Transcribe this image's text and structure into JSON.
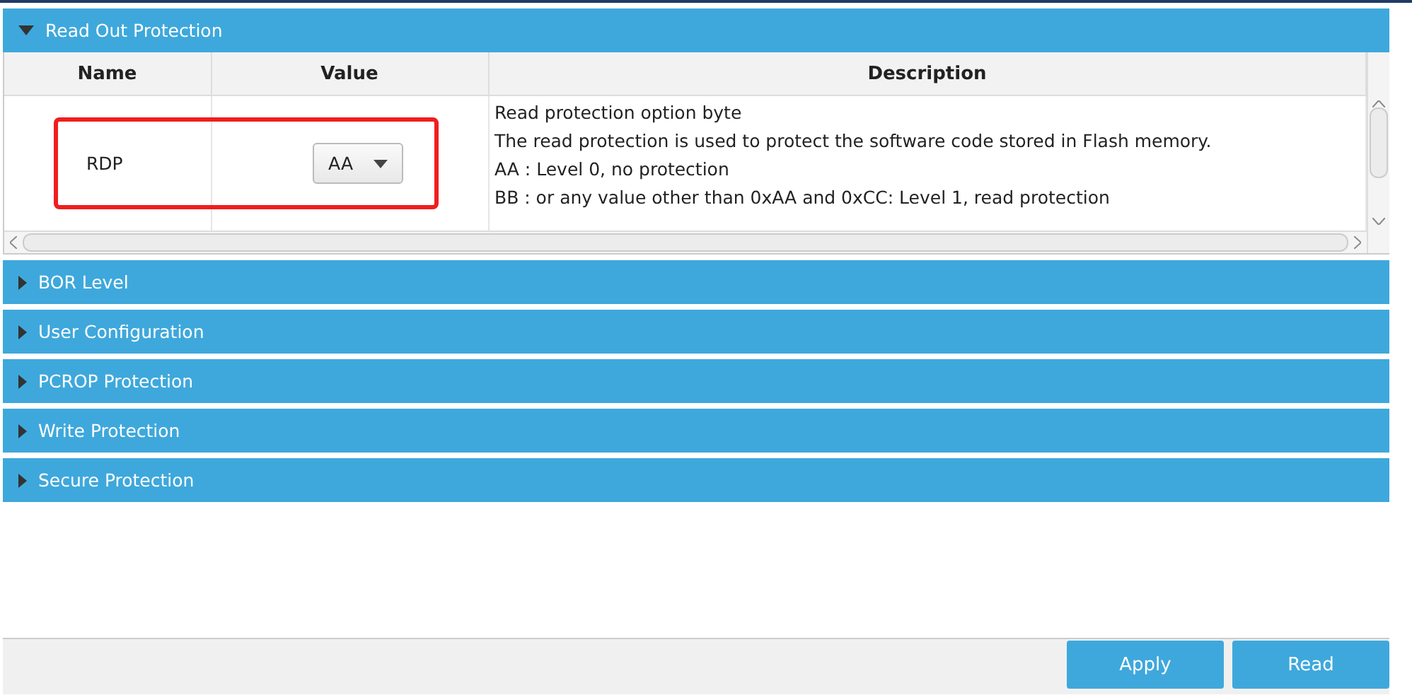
{
  "sections": [
    {
      "title": "Read Out Protection",
      "expanded": true,
      "table": {
        "columns": [
          "Name",
          "Value",
          "Description"
        ],
        "rows": [
          {
            "name": "RDP",
            "value": "AA",
            "description": [
              "Read protection option byte",
              "The read protection is used to protect the software code stored in Flash memory.",
              "AA : Level 0, no protection",
              "BB : or any value other than 0xAA and 0xCC: Level 1, read protection"
            ],
            "highlighted": true
          }
        ]
      }
    },
    {
      "title": "BOR Level",
      "expanded": false
    },
    {
      "title": "User Configuration",
      "expanded": false
    },
    {
      "title": "PCROP Protection",
      "expanded": false
    },
    {
      "title": "Write Protection",
      "expanded": false
    },
    {
      "title": "Secure Protection",
      "expanded": false
    }
  ],
  "buttons": [
    "Apply",
    "Read"
  ]
}
